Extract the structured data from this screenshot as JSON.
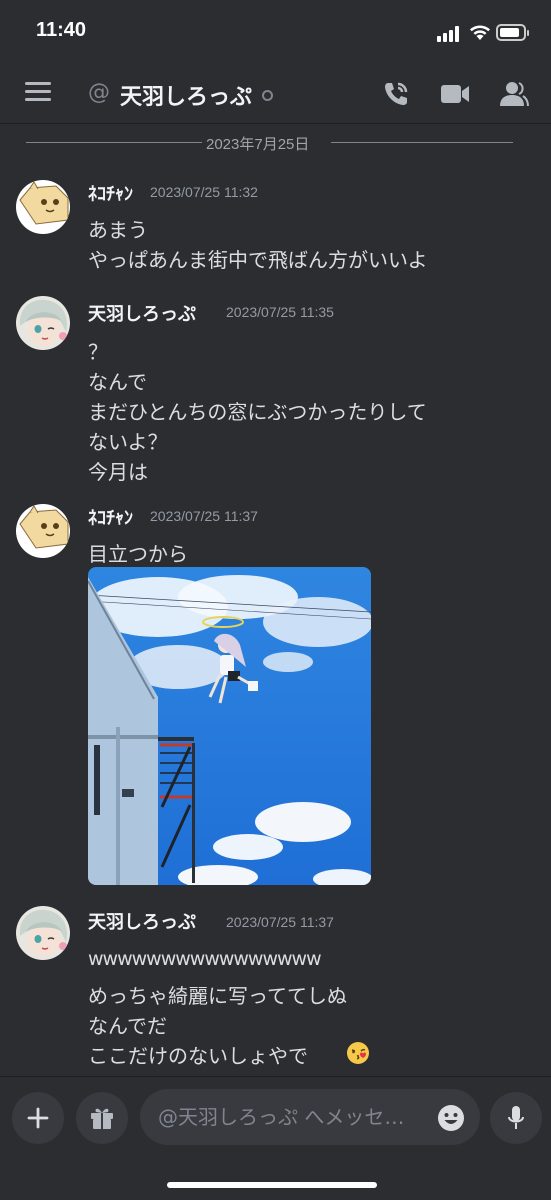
{
  "status_bar": {
    "time": "11:40",
    "battery_level": 0.85
  },
  "header": {
    "channel_prefix_icon": "at-icon",
    "title": "天羽しろっぷ",
    "icons": [
      "menu-icon",
      "phone-call-icon",
      "video-camera-icon",
      "members-icon"
    ]
  },
  "date_divider": "2023年7月25日",
  "messages": [
    {
      "author": "ﾈｺﾁｬﾝ",
      "timestamp": "2023/07/25 11:32",
      "lines": [
        "あまう",
        "やっぱあんま街中で飛ばん方がいいよ"
      ]
    },
    {
      "author": "天羽しろっぷ",
      "timestamp": "2023/07/25 11:35",
      "lines": [
        "？",
        "なんで",
        "まだひとんちの窓にぶつかったりして",
        "ないよ？",
        "今月は"
      ]
    },
    {
      "author": "ﾈｺﾁｬﾝ",
      "timestamp": "2023/07/25 11:37",
      "lines": [
        "目立つから"
      ],
      "attachment": "photo-of-flying-girl-over-building"
    },
    {
      "author": "天羽しろっぷ",
      "timestamp": "2023/07/25 11:37",
      "lines": [
        "wwwwwwwwwwwwwwww",
        "めっちゃ綺麗に写っててしぬ",
        "なんでだ",
        "ここだけのないしょやで"
      ],
      "emoji": "kissing-face-emoji"
    }
  ],
  "composer": {
    "placeholder": "@天羽しろっぷ へメッセ…",
    "icons": [
      "plus-icon",
      "gift-icon",
      "emoji-icon",
      "microphone-icon"
    ]
  },
  "colors": {
    "background": "#2b2d31",
    "input": "#383a40",
    "text": "#dbdee1",
    "muted": "#949ba4"
  }
}
